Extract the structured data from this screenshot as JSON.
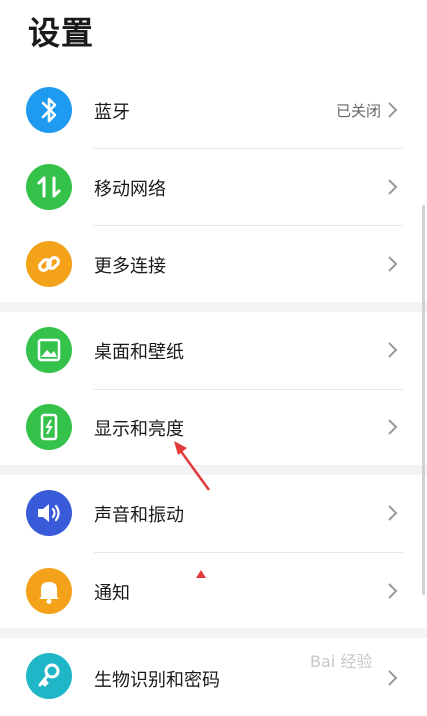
{
  "page": {
    "title": "设置"
  },
  "rows": {
    "bluetooth": {
      "label": "蓝牙",
      "status": "已关闭",
      "icon": "bluetooth-icon",
      "color": "#1e9bf0"
    },
    "mobile_network": {
      "label": "移动网络",
      "icon": "data-arrows-icon",
      "color": "#35c24a"
    },
    "more_connections": {
      "label": "更多连接",
      "icon": "link-icon",
      "color": "#f5a21b"
    },
    "wallpaper": {
      "label": "桌面和壁纸",
      "icon": "image-icon",
      "color": "#35c24a"
    },
    "display": {
      "label": "显示和亮度",
      "icon": "phone-brightness-icon",
      "color": "#35c24a"
    },
    "sound": {
      "label": "声音和振动",
      "icon": "speaker-icon",
      "color": "#3a5bd9"
    },
    "notifications": {
      "label": "通知",
      "icon": "bell-icon",
      "color": "#f5a21b"
    },
    "biometrics": {
      "label": "生物识别和密码",
      "icon": "key-icon",
      "color": "#1fb6c8"
    }
  },
  "watermark": {
    "text": "Bai 经验"
  },
  "annotation": {
    "arrow_color": "#e03a3a"
  }
}
